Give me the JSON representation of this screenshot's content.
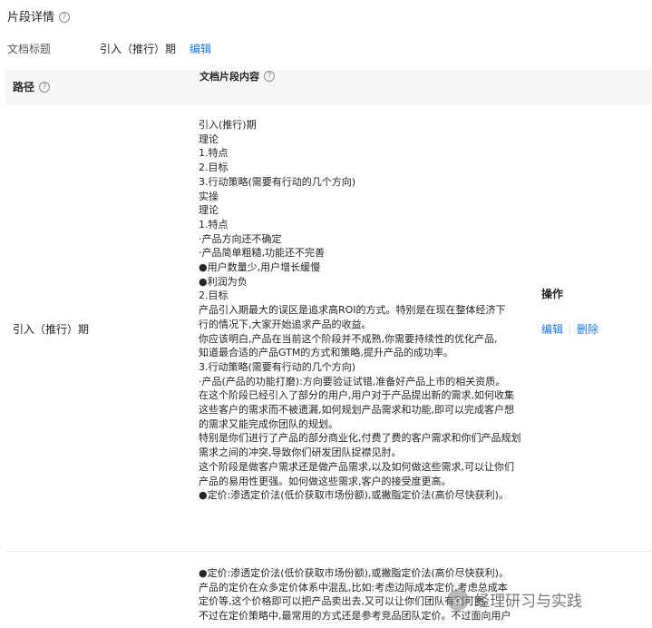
{
  "header": {
    "title": "片段详情",
    "help_glyph": "?"
  },
  "meta": {
    "label": "文档标题",
    "value": "引入（推行）期",
    "edit_label": "编辑"
  },
  "table": {
    "columns": {
      "path": "路径",
      "content": "文档片段内容",
      "actions": "操作"
    },
    "rows": [
      {
        "path": "引入（推行）期",
        "lines": [
          "引入(推行)期",
          "理论",
          "1.特点",
          "2.目标",
          "3.行动策略(需要有行动的几个方向)",
          "实操",
          "理论",
          "1.特点",
          "·产品方向还不确定",
          "·产品简单粗糙,功能还不完善",
          "●用户数量少,用户增长缓慢",
          "●利润为负",
          "2.目标",
          "产品引入期最大的误区是追求高ROI的方式。特别是在现在整体经济下",
          "行的情况下,大家开始追求产品的收益。",
          "你应该明白,产品在当前这个阶段并不成熟,你需要持续性的优化产品,",
          "知道最合适的产品GTM的方式和策略,提升产品的成功率。",
          "3.行动策略(需要有行动的几个方向)",
          "·产品(产品的功能打磨):方向要验证试错,准备好产品上市的相关资质。",
          "在这个阶段已经引入了部分的用户,用户对于产品提出新的需求,如何收集",
          "这些客户的需求而不被遗漏,如何规划产品需求和功能,即可以完成客户想",
          "的需求又能完成你团队的规划。",
          "特别是你们进行了产品的部分商业化,付费了费的客户需求和你们产品规划",
          "需求之间的冲突,导致你们研发团队捉襟见肘。",
          "这个阶段是做客户需求还是做产品需求,以及如何做这些需求,可以让你们",
          "产品的易用性更强。如何做这些需求,客户的接受度更高。",
          "●定价:渗透定价法(低价获取市场份额),或撇脂定价法(高价尽快获利)。"
        ],
        "actions": {
          "edit": "编辑",
          "delete": "删除"
        }
      },
      {
        "lines": [
          "●定价:渗透定价法(低价获取市场份额),或撇脂定价法(高价尽快获利)。",
          "产品的定价在众多定价体系中混乱,比如:考虑边际成本定价,考虑总成本",
          "定价等,这个价格即可以把产品卖出去,又可以让你们团队有利可图。",
          "不过在定价策略中,最常用的方式还是参考竞品团队定价。不过面向用户"
        ]
      }
    ]
  },
  "watermark": {
    "text": "经理研习与实践"
  }
}
